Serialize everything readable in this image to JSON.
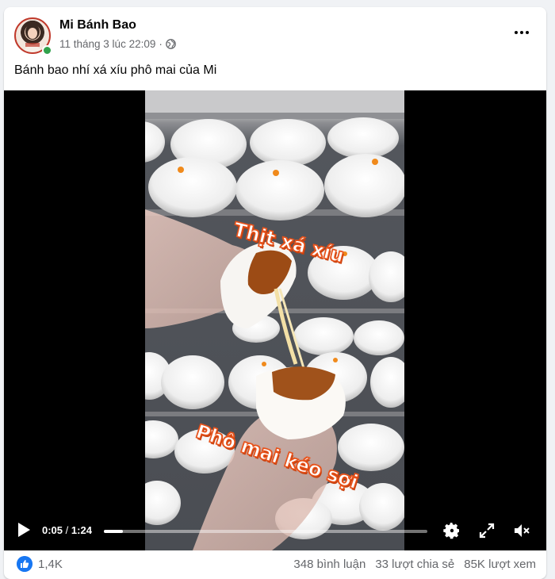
{
  "post": {
    "author": "Mi Bánh Bao",
    "timestamp": "11 tháng 3 lúc 22:09",
    "separator": "·",
    "privacy_icon": "globe-icon",
    "caption": "Bánh bao nhí xá xíu phô mai của Mi",
    "online": true
  },
  "video": {
    "overlay_top": "Thịt xá xíu",
    "overlay_bottom": "Phô mai kéo sợi",
    "current_time": "0:05",
    "time_separator": "/",
    "duration": "1:24",
    "progress_fraction": 0.06,
    "icons": [
      "play-icon",
      "gear-icon",
      "fullscreen-icon",
      "mute-icon"
    ]
  },
  "footer": {
    "like_count": "1,4K",
    "comments": "348 bình luận",
    "shares": "33 lượt chia sẻ",
    "views": "85K lượt xem"
  },
  "colors": {
    "accent": "#1877f2",
    "online": "#31a24c",
    "overlay_stroke": "#e8531b",
    "secondary_text": "#65676b"
  }
}
